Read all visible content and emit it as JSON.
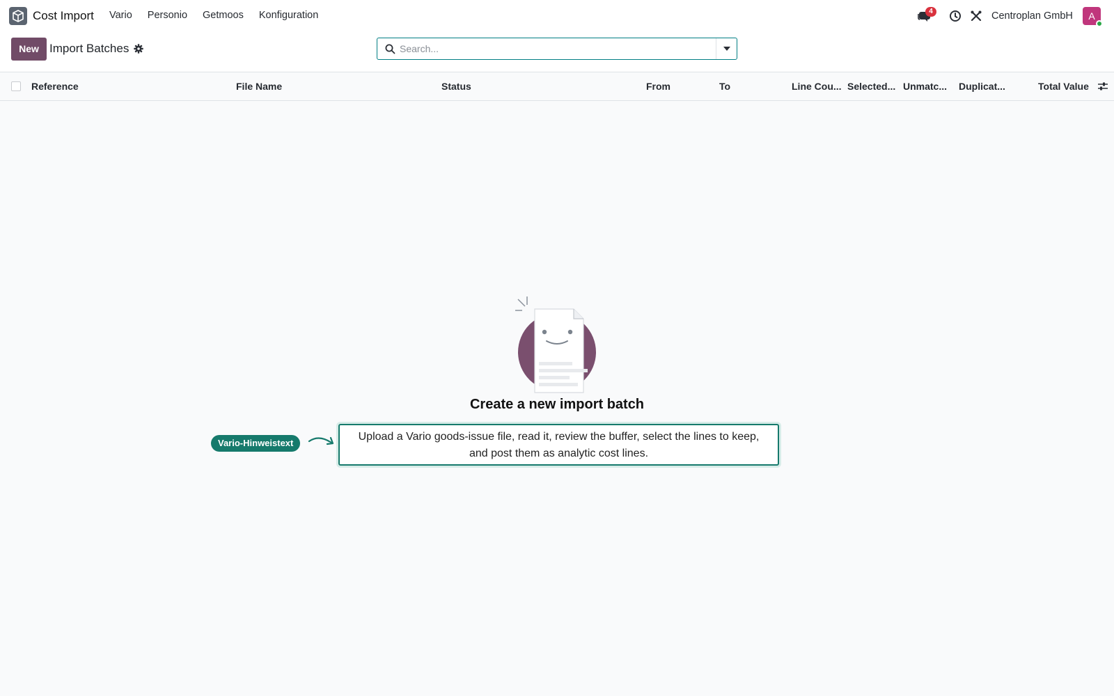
{
  "navbar": {
    "app_name": "Cost Import",
    "menu": [
      "Vario",
      "Personio",
      "Getmoos",
      "Konfiguration"
    ],
    "chat_badge": "4",
    "company": "Centroplan GmbH",
    "avatar_letter": "A"
  },
  "control_panel": {
    "new_label": "New",
    "title": "Import Batches",
    "search_placeholder": "Search..."
  },
  "list": {
    "columns": [
      "Reference",
      "File Name",
      "Status",
      "From",
      "To",
      "Line Cou...",
      "Selected...",
      "Unmatc...",
      "Duplicat...",
      "Total Value"
    ]
  },
  "empty_state": {
    "title": "Create a new import batch",
    "hint_badge": "Vario-Hinweistext",
    "hint_line1": "Upload a Vario goods-issue file, read it, review the buffer, select the lines to keep,",
    "hint_line2": "and post them as analytic cost lines."
  },
  "colors": {
    "brand": "#714b67",
    "accent": "#017e84",
    "hint": "#167a6c",
    "badge": "#d9323e",
    "avatar": "#c0367c"
  }
}
